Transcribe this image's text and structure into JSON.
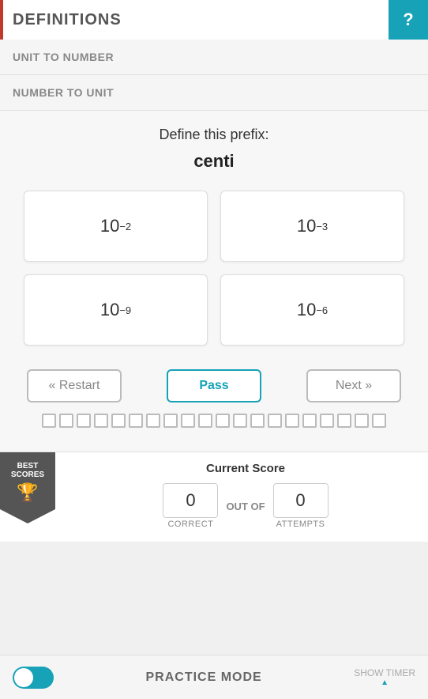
{
  "header": {
    "title": "DEFINITIONS",
    "help_label": "?"
  },
  "nav": {
    "tab1": "UNIT TO NUMBER",
    "tab2": "NUMBER TO UNIT"
  },
  "quiz": {
    "prompt": "Define this prefix:",
    "word": "centi",
    "answers": [
      {
        "base": "10",
        "exp": "-2"
      },
      {
        "base": "10",
        "exp": "-3"
      },
      {
        "base": "10",
        "exp": "-9"
      },
      {
        "base": "10",
        "exp": "-6"
      }
    ]
  },
  "buttons": {
    "restart": "« Restart",
    "pass": "Pass",
    "next": "Next »"
  },
  "progress": {
    "total_dots": 20
  },
  "score": {
    "title": "Current Score",
    "correct_value": "0",
    "correct_label": "CORRECT",
    "out_of": "OUT OF",
    "attempts_value": "0",
    "attempts_label": "ATTEMPTS"
  },
  "best_scores": {
    "line1": "BEST",
    "line2": "SCORES"
  },
  "footer": {
    "label": "PRACTICE MODE",
    "show_timer": "SHOW TIMER"
  }
}
